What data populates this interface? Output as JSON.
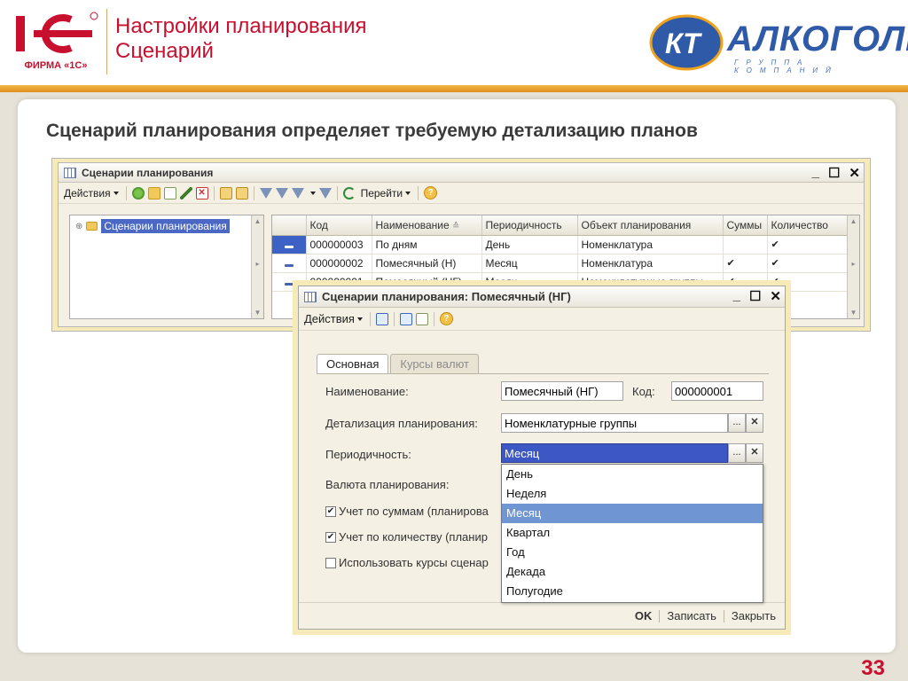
{
  "header": {
    "logo_1c_caption": "ФИРМА «1С»",
    "title_line1": "Настройки планирования",
    "title_line2": "Сценарий",
    "brand_name": "АЛКОГОЛЬ",
    "brand_mark": "КТ",
    "brand_sub": "ГРУППА КОМПАНИЙ"
  },
  "subtitle": "Сценарий планирования определяет требуемую детализацию планов",
  "page_number": "33",
  "list_window": {
    "title": "Сценарии планирования",
    "actions_label": "Действия",
    "goto_label": "Перейти",
    "tree_root": "Сценарии планирования",
    "columns": [
      "Код",
      "Наименование",
      "Периодичность",
      "Объект планирования",
      "Суммы",
      "Количество"
    ],
    "rows": [
      {
        "code": "000000003",
        "name": "По дням",
        "period": "День",
        "object": "Номенклатура",
        "sums": "",
        "qty": "✔"
      },
      {
        "code": "000000002",
        "name": "Помесячный (Н)",
        "period": "Месяц",
        "object": "Номенклатура",
        "sums": "✔",
        "qty": "✔"
      },
      {
        "code": "000000001",
        "name": "Помесячный (НГ)",
        "period": "Месяц",
        "object": "Номенклатурные группы",
        "sums": "✔",
        "qty": "✔"
      }
    ]
  },
  "dialog": {
    "title": "Сценарии планирования: Помесячный (НГ)",
    "actions_label": "Действия",
    "tab_main": "Основная",
    "tab_currency": "Курсы валют",
    "name_label": "Наименование:",
    "name_value": "Помесячный (НГ)",
    "code_label": "Код:",
    "code_value": "000000001",
    "detail_label": "Детализация планирования:",
    "detail_value": "Номенклатурные группы",
    "period_label": "Периодичность:",
    "period_value": "Месяц",
    "currency_label": "Валюта планирования:",
    "chk_sums": "Учет по суммам (планирова",
    "chk_qty": "Учет по количеству (планир",
    "chk_rates": "Использовать курсы сценар",
    "btn_ok": "OK",
    "btn_save": "Записать",
    "btn_close": "Закрыть"
  },
  "period_options": [
    "День",
    "Неделя",
    "Месяц",
    "Квартал",
    "Год",
    "Декада",
    "Полугодие"
  ],
  "period_selected_index": 2,
  "colors": {
    "accent_red": "#c8102e",
    "selection_blue": "#3d58c4",
    "list_highlight": "#6f95d2",
    "frame_yellow": "#f7eab9"
  }
}
